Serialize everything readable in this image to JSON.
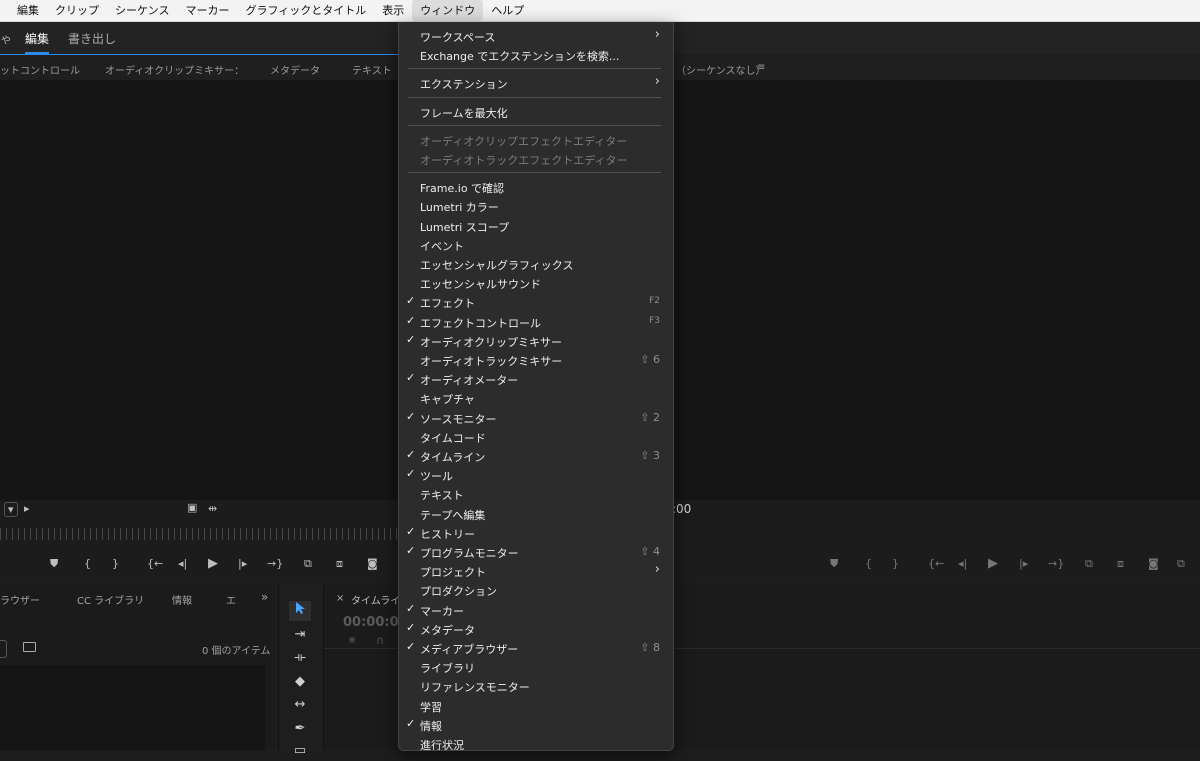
{
  "menubar": {
    "items": [
      "編集",
      "クリップ",
      "シーケンス",
      "マーカー",
      "グラフィックとタイトル",
      "表示",
      "ウィンドウ",
      "ヘルプ"
    ]
  },
  "workspace": {
    "partial_tab": "ゃ",
    "edit_tab": "編集",
    "export_tab": "書き出し"
  },
  "panels": {
    "tabs": [
      "ットコントロール",
      "オーディオクリップミキサー：",
      "メタデータ",
      "テキスト"
    ],
    "program_title": "（シーケンスなし）",
    "program_menu": "≡",
    "program_timecode": ":00"
  },
  "source_controls": [
    "▾",
    "▸",
    "▣",
    "⇹",
    "⛊",
    "{",
    "}",
    "{←",
    "◂|",
    "▶",
    "|▸",
    "→}",
    "⧉",
    "⧈",
    "◙"
  ],
  "program_controls": [
    "⛊",
    "{",
    "}",
    "{←",
    "◂|",
    "▶",
    "|▸",
    "→}",
    "⧉",
    "⧈",
    "◙",
    "⧉"
  ],
  "bottom_panel": {
    "tabs": [
      "ラウザー",
      "CC ライブラリ",
      "情報",
      "エ",
      "»"
    ],
    "item_count": "0 個のアイテム"
  },
  "tools": [
    "select-tool",
    "track-select-tool",
    "ripple-edit-tool",
    "razor-tool",
    "slip-tool",
    "pen-tool",
    "rectangle-tool"
  ],
  "timeline": {
    "tab_close": "×",
    "tab_label": "タイムライ",
    "timecode": "00:00:00"
  },
  "window_menu": {
    "items": [
      {
        "label": "ワークスペース",
        "submenu": true
      },
      {
        "label": "Exchange でエクステンションを検索..."
      },
      {
        "separator": true
      },
      {
        "label": "エクステンション",
        "submenu": true
      },
      {
        "separator": true
      },
      {
        "label": "フレームを最大化"
      },
      {
        "separator": true
      },
      {
        "label": "オーディオクリップエフェクトエディター",
        "disabled": true
      },
      {
        "label": "オーディオトラックエフェクトエディター",
        "disabled": true
      },
      {
        "separator": true
      },
      {
        "label": "Frame.io で確認"
      },
      {
        "label": "Lumetri カラー"
      },
      {
        "label": "Lumetri スコープ"
      },
      {
        "label": "イベント"
      },
      {
        "label": "エッセンシャルグラフィックス"
      },
      {
        "label": "エッセンシャルサウンド"
      },
      {
        "label": "エフェクト",
        "checked": true,
        "shortcut": "F2"
      },
      {
        "label": "エフェクトコントロール",
        "checked": true,
        "shortcut": "F3"
      },
      {
        "label": "オーディオクリップミキサー",
        "checked": true
      },
      {
        "label": "オーディオトラックミキサー",
        "shortcut": "⇧ 6"
      },
      {
        "label": "オーディオメーター",
        "checked": true
      },
      {
        "label": "キャプチャ"
      },
      {
        "label": "ソースモニター",
        "checked": true,
        "shortcut": "⇧ 2"
      },
      {
        "label": "タイムコード"
      },
      {
        "label": "タイムライン",
        "checked": true,
        "shortcut": "⇧ 3"
      },
      {
        "label": "ツール",
        "checked": true
      },
      {
        "label": "テキスト"
      },
      {
        "label": "テープへ編集"
      },
      {
        "label": "ヒストリー",
        "checked": true
      },
      {
        "label": "プログラムモニター",
        "checked": true,
        "shortcut": "⇧ 4"
      },
      {
        "label": "プロジェクト",
        "submenu": true
      },
      {
        "label": "プロダクション"
      },
      {
        "label": "マーカー",
        "checked": true
      },
      {
        "label": "メタデータ",
        "checked": true
      },
      {
        "label": "メディアブラウザー",
        "checked": true,
        "shortcut": "⇧ 8"
      },
      {
        "label": "ライブラリ"
      },
      {
        "label": "リファレンスモニター"
      },
      {
        "label": "学習"
      },
      {
        "label": "情報",
        "checked": true
      },
      {
        "label": "進行状況"
      }
    ]
  }
}
